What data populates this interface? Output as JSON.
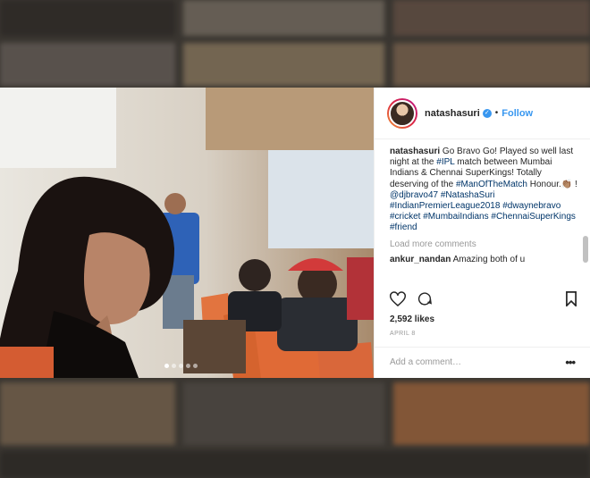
{
  "post": {
    "username": "natashasuri",
    "follow_label": "Follow",
    "separator": "•",
    "caption_user": "natashasuri",
    "caption_parts": [
      {
        "text": " Go Bravo Go! Played so well last night at the ",
        "tag": false
      },
      {
        "text": "#IPL",
        "tag": true
      },
      {
        "text": " match between Mumbai Indians & Chennai SuperKings! Totally deserving of the ",
        "tag": false
      },
      {
        "text": "#ManOfTheMatch",
        "tag": true
      },
      {
        "text": " Honour.👏🏽 ! ",
        "tag": false
      },
      {
        "text": "@djbravo47",
        "tag": true
      },
      {
        "text": " ",
        "tag": false
      },
      {
        "text": "#NatashaSuri",
        "tag": true
      },
      {
        "text": " ",
        "tag": false
      },
      {
        "text": "#IndianPremierLeague2018",
        "tag": true
      },
      {
        "text": " ",
        "tag": false
      },
      {
        "text": "#dwaynebravo",
        "tag": true
      },
      {
        "text": " ",
        "tag": false
      },
      {
        "text": "#cricket",
        "tag": true
      },
      {
        "text": " ",
        "tag": false
      },
      {
        "text": "#MumbaiIndians",
        "tag": true
      },
      {
        "text": " ",
        "tag": false
      },
      {
        "text": "#ChennaiSuperKings",
        "tag": true
      },
      {
        "text": " ",
        "tag": false
      },
      {
        "text": "#friend",
        "tag": true
      }
    ],
    "load_more": "Load more comments",
    "comment_user": "ankur_nandan",
    "comment_text": "Amazing both of u",
    "likes": "2,592 likes",
    "date": "APRIL 8",
    "add_comment_placeholder": "Add a comment…",
    "more_label": "•••",
    "carousel_dots": 5,
    "carousel_active": 0
  },
  "icons": {
    "like": "heart-icon",
    "comment": "comment-icon",
    "save": "bookmark-icon",
    "verified": "verified-badge-icon"
  },
  "colors": {
    "link": "#3897f0",
    "hashtag": "#003569",
    "muted": "#999999",
    "text": "#262626"
  }
}
